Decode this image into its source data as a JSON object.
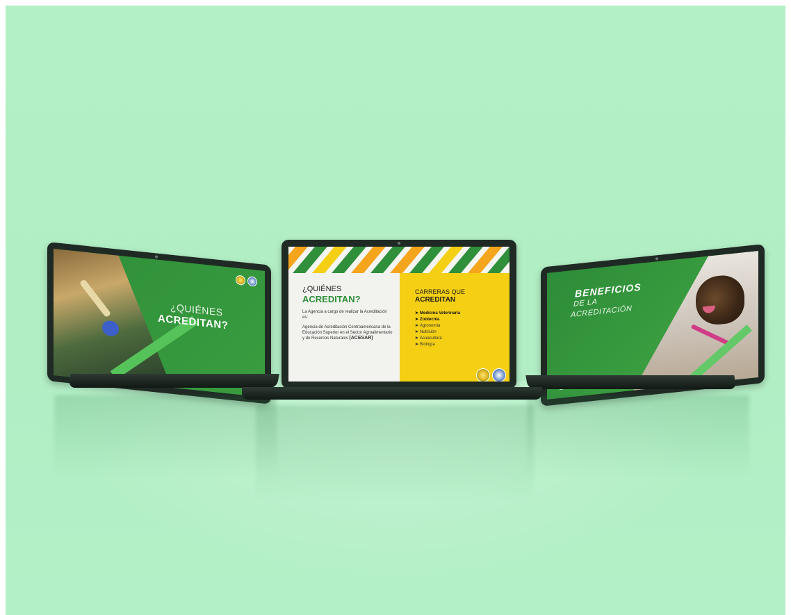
{
  "left_slide": {
    "title_line1": "¿QUIÉNES",
    "title_line2": "ACREDITAN?"
  },
  "center_slide": {
    "heading_line1": "¿QUIÉNES",
    "heading_line2": "ACREDITAN?",
    "paragraph1": "La Agencia a cargo de realizar la Acreditación es:",
    "paragraph2_prefix": "Agencia de Acreditación Centroamericana de la Educación Superior en el Sector Agroalimentario y de Recursos Naturales ",
    "paragraph2_bold": "(ACESAR)",
    "right_heading_line1": "CARRERAS QUE",
    "right_heading_line2": "ACREDITAN",
    "careers": [
      {
        "label": "Medicina Veterinaria",
        "bold": true
      },
      {
        "label": "Zootecnia",
        "bold": true
      },
      {
        "label": "Agronomía",
        "bold": false
      },
      {
        "label": "Nutrición",
        "bold": false
      },
      {
        "label": "Acuacultura",
        "bold": false
      },
      {
        "label": "Biología",
        "bold": false
      }
    ],
    "bullet_glyph": "➤",
    "chevron_colors": [
      "#f4a51c",
      "#2f8f3a",
      "#f4cf14",
      "#2f8f3a",
      "#f4a51c",
      "#2f8f3a"
    ]
  },
  "right_slide": {
    "title_line1": "BENEFICIOS",
    "title_line2": "DE LA",
    "title_line3": "ACREDITACIÓN"
  },
  "colors": {
    "background": "#b3f0c5",
    "brand_green": "#2f8f3a",
    "brand_yellow": "#f4cf14",
    "brand_orange": "#f4a51c"
  }
}
